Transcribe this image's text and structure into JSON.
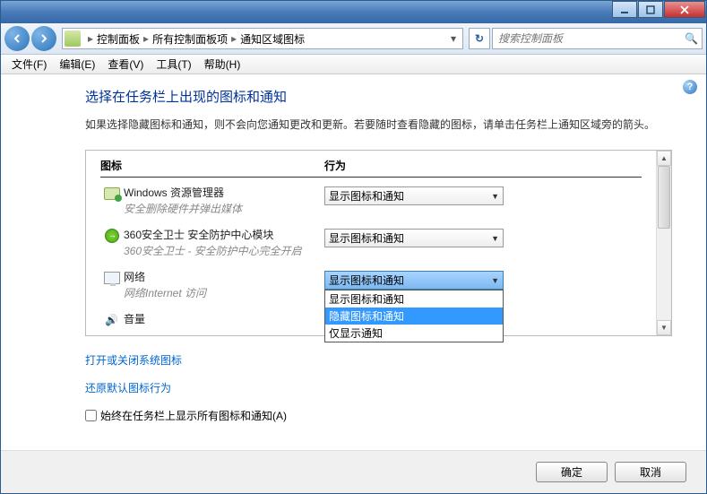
{
  "breadcrumb": {
    "part1": "控制面板",
    "part2": "所有控制面板项",
    "part3": "通知区域图标"
  },
  "search": {
    "placeholder": "搜索控制面板"
  },
  "menu": {
    "file": "文件(F)",
    "edit": "编辑(E)",
    "view": "查看(V)",
    "tools": "工具(T)",
    "help": "帮助(H)"
  },
  "heading": "选择在任务栏上出现的图标和通知",
  "desc": "如果选择隐藏图标和通知，则不会向您通知更改和更新。若要随时查看隐藏的图标，请单击任务栏上通知区域旁的箭头。",
  "columns": {
    "icon": "图标",
    "behavior": "行为"
  },
  "rows": [
    {
      "name": "Windows 资源管理器",
      "sub": "安全删除硬件并弹出媒体",
      "value": "显示图标和通知"
    },
    {
      "name": "360安全卫士 安全防护中心模块",
      "sub": "360安全卫士 - 安全防护中心完全开启",
      "value": "显示图标和通知"
    },
    {
      "name": "网络",
      "sub": "网络Internet 访问",
      "value": "显示图标和通知"
    },
    {
      "name": "音量",
      "sub": "",
      "value": ""
    }
  ],
  "options": [
    "显示图标和通知",
    "隐藏图标和通知",
    "仅显示通知"
  ],
  "links": {
    "sys": "打开或关闭系统图标",
    "restore": "还原默认图标行为"
  },
  "checkbox": "始终在任务栏上显示所有图标和通知(A)",
  "buttons": {
    "ok": "确定",
    "cancel": "取消"
  }
}
